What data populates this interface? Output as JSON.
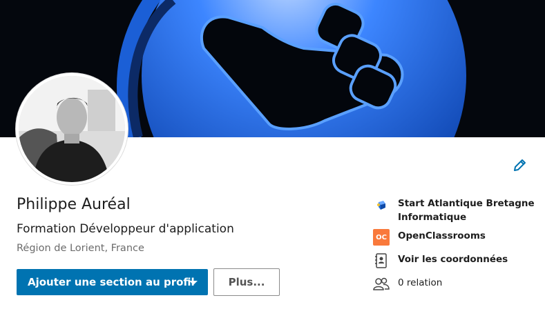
{
  "profile": {
    "name": "Philippe Auréal",
    "headline": "Formation Développeur d'application",
    "location": "Région de Lorient, France"
  },
  "actions": {
    "add_section_label": "Ajouter une section au profil",
    "more_label": "Plus..."
  },
  "sidebar": {
    "company": "Start Atlantique Bretagne Informatique",
    "school": "OpenClassrooms",
    "school_logo_text": "OC",
    "contact": "Voir les coordonnées",
    "connections": "0 relation"
  },
  "colors": {
    "accent": "#0073b1",
    "banner_blue": "#1a6fe0",
    "openclassrooms": "#f9793b"
  },
  "icons": {
    "edit": "pencil-icon",
    "company": "company-logo-icon",
    "contact": "contact-book-icon",
    "connections": "people-icon",
    "dropdown": "caret-down-icon"
  }
}
